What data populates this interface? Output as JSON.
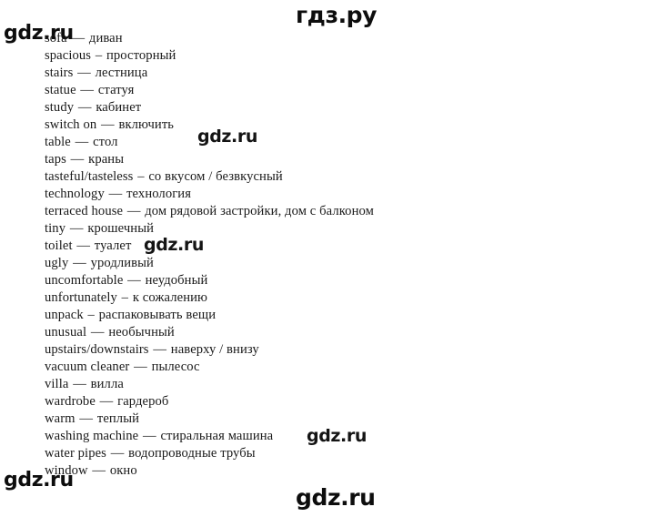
{
  "page": {
    "background_color": "#ffffff",
    "text_color": "#1a1a1a"
  },
  "watermarks": {
    "color": "#0d0d0d",
    "top_right": "гдз.ру",
    "top_left": "gdz.ru",
    "middle_1": "gdz.ru",
    "middle_2": "gdz.ru",
    "middle_3": "gdz.ru",
    "bottom_left": "gdz.ru",
    "bottom_middle": "gdz.ru"
  },
  "vocabulary": {
    "entries": [
      {
        "term": "sofa",
        "separator": "—",
        "translation": "диван"
      },
      {
        "term": "spacious",
        "separator": "–",
        "translation": "просторный"
      },
      {
        "term": "stairs",
        "separator": "—",
        "translation": "лестница"
      },
      {
        "term": "statue",
        "separator": "—",
        "translation": "статуя"
      },
      {
        "term": "study",
        "separator": "—",
        "translation": "кабинет"
      },
      {
        "term": "switch on",
        "separator": "—",
        "translation": "включить"
      },
      {
        "term": "table",
        "separator": "—",
        "translation": "стол"
      },
      {
        "term": "taps",
        "separator": "—",
        "translation": "краны"
      },
      {
        "term": "tasteful/tasteless",
        "separator": "–",
        "translation": "со вкусом / безвкусный"
      },
      {
        "term": "technology",
        "separator": "—",
        "translation": "технология"
      },
      {
        "term": "terraced house",
        "separator": "—",
        "translation": "дом рядовой застройки, дом с балконом"
      },
      {
        "term": "tiny",
        "separator": "—",
        "translation": "крошечный"
      },
      {
        "term": "toilet",
        "separator": "—",
        "translation": "туалет"
      },
      {
        "term": "ugly",
        "separator": "—",
        "translation": "уродливый"
      },
      {
        "term": "uncomfortable",
        "separator": "—",
        "translation": "неудобный"
      },
      {
        "term": "unfortunately",
        "separator": "–",
        "translation": "к сожалению"
      },
      {
        "term": "unpack",
        "separator": "–",
        "translation": "распаковывать вещи"
      },
      {
        "term": "unusual",
        "separator": "—",
        "translation": "необычный"
      },
      {
        "term": "upstairs/downstairs",
        "separator": "—",
        "translation": "наверху / внизу"
      },
      {
        "term": "vacuum cleaner",
        "separator": "—",
        "translation": "пылесос"
      },
      {
        "term": "villa",
        "separator": "—",
        "translation": "вилла"
      },
      {
        "term": "wardrobe",
        "separator": "—",
        "translation": "гардероб"
      },
      {
        "term": "warm",
        "separator": "—",
        "translation": "теплый"
      },
      {
        "term": "washing machine",
        "separator": "—",
        "translation": "стиральная машина"
      },
      {
        "term": "water pipes",
        "separator": "—",
        "translation": "водопроводные трубы"
      },
      {
        "term": "window",
        "separator": "—",
        "translation": "окно"
      }
    ]
  }
}
